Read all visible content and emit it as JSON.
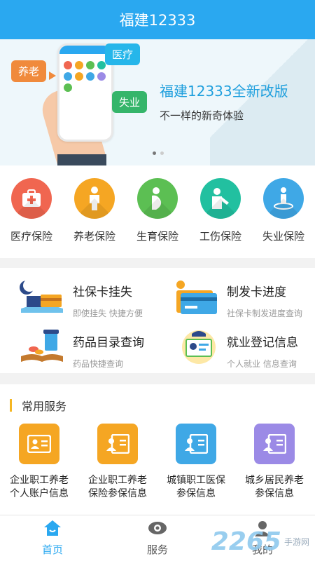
{
  "header": {
    "title": "福建12333"
  },
  "banner": {
    "bubble_left": "养老",
    "bubble_top": "医疗",
    "bubble_right": "失业",
    "title": "福建12333全新改版",
    "subtitle": "不一样的新奇体验"
  },
  "insurance": [
    {
      "label": "医疗保险",
      "color": "#f06650",
      "icon": "medical-kit-icon"
    },
    {
      "label": "养老保险",
      "color": "#f5a623",
      "icon": "elderly-icon"
    },
    {
      "label": "生育保险",
      "color": "#5cbf53",
      "icon": "pregnancy-icon"
    },
    {
      "label": "工伤保险",
      "color": "#22c0a0",
      "icon": "injury-icon"
    },
    {
      "label": "失业保险",
      "color": "#3fa8e6",
      "icon": "unemployment-icon"
    }
  ],
  "quick": [
    {
      "title": "社保卡挂失",
      "sub": "即使挂失  快捷方便",
      "icon": "card-loss-icon"
    },
    {
      "title": "制发卡进度",
      "sub": "社保卡制发进度查询",
      "icon": "card-progress-icon"
    },
    {
      "title": "药品目录查询",
      "sub": "药品快捷查询",
      "icon": "medicine-icon"
    },
    {
      "title": "就业登记信息",
      "sub": "个人就业  信息查询",
      "icon": "employment-icon"
    }
  ],
  "common": {
    "title": "常用服务",
    "items": [
      {
        "line1": "企业职工养老",
        "line2": "个人账户信息",
        "color": "#f5a623"
      },
      {
        "line1": "企业职工养老",
        "line2": "保险参保信息",
        "color": "#f5a623"
      },
      {
        "line1": "城镇职工医保",
        "line2": "参保信息",
        "color": "#3fa8e6"
      },
      {
        "line1": "城乡居民养老",
        "line2": "参保信息",
        "color": "#9b8ae6"
      }
    ]
  },
  "tabs": [
    {
      "label": "首页",
      "icon": "home-icon"
    },
    {
      "label": "服务",
      "icon": "eye-icon"
    },
    {
      "label": "我的",
      "icon": "user-icon"
    }
  ],
  "watermark": {
    "num": "2265",
    "text": "手游网"
  },
  "colors": {
    "primary": "#2aa8f0",
    "accent": "#f5b623"
  }
}
